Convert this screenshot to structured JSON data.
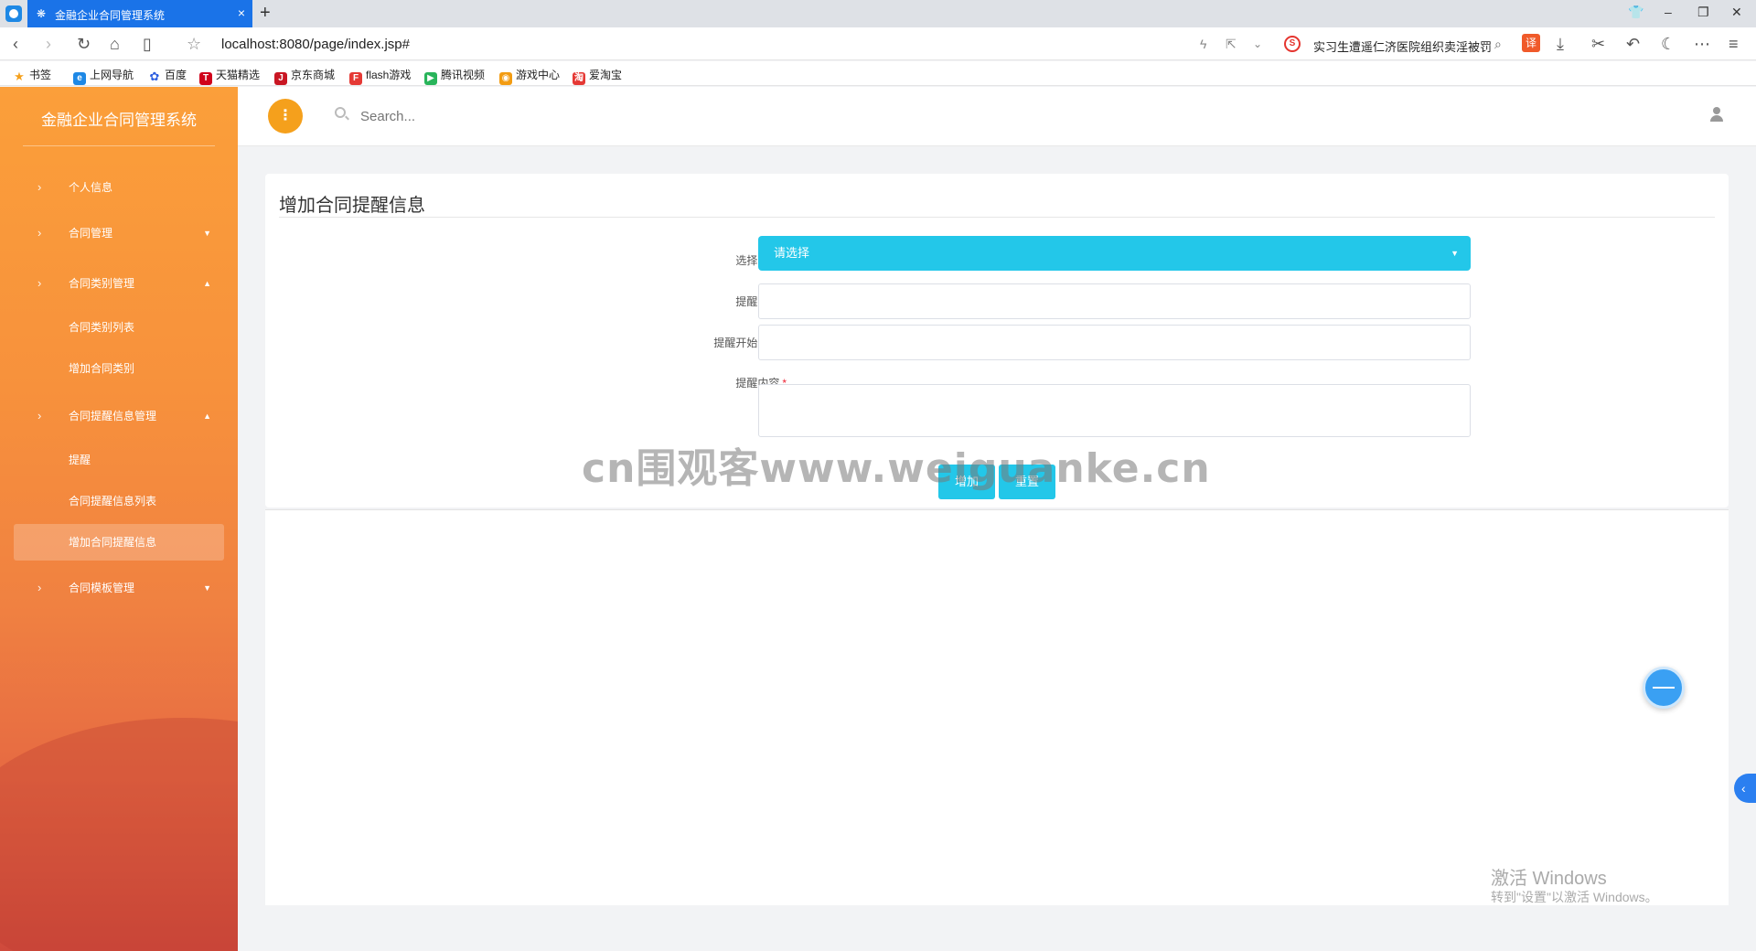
{
  "browser": {
    "tab_title": "金融企业合同管理系统",
    "tab_close": "×",
    "new_tab": "+",
    "address": "localhost:8080/page/index.jsp#",
    "news_ticker": "实习生遭遥仁济医院组织卖淫被罚",
    "translate_label": "译",
    "bookmarks": [
      {
        "label": "书签",
        "icon": "star-icon",
        "color": "#f5a01c"
      },
      {
        "label": "上网导航",
        "icon": "e-icon",
        "color": "#1e88e5"
      },
      {
        "label": "百度",
        "icon": "baidu-paw-icon",
        "color": "#2d5fe0"
      },
      {
        "label": "天猫精选",
        "icon": "tmall-icon",
        "color": "#d0021b"
      },
      {
        "label": "京东商城",
        "icon": "jd-icon",
        "color": "#c91623"
      },
      {
        "label": "flash游戏",
        "icon": "flash-icon",
        "color": "#e53935"
      },
      {
        "label": "腾讯视频",
        "icon": "tencent-video-icon",
        "color": "#28b45a"
      },
      {
        "label": "游戏中心",
        "icon": "game-center-icon",
        "color": "#f39c12"
      },
      {
        "label": "爱淘宝",
        "icon": "aitaobao-icon",
        "color": "#e53935"
      }
    ]
  },
  "sidebar": {
    "brand": "金融企业合同管理系统",
    "items": [
      {
        "label": "个人信息",
        "caret": ""
      },
      {
        "label": "合同管理",
        "caret": "▼"
      },
      {
        "label": "合同类别管理",
        "caret": "▲"
      },
      {
        "label": "合同类别列表"
      },
      {
        "label": "增加合同类别"
      },
      {
        "label": "合同提醒信息管理",
        "caret": "▲"
      },
      {
        "label": "提醒"
      },
      {
        "label": "合同提醒信息列表"
      },
      {
        "label": "增加合同提醒信息"
      },
      {
        "label": "合同模板管理",
        "caret": "▼"
      }
    ]
  },
  "header": {
    "search_placeholder": "Search..."
  },
  "form": {
    "title": "增加合同提醒信息",
    "required_mark": "*",
    "contract_label": "选择合同",
    "contract_value": "请选择",
    "name_label": "提醒名称",
    "start_label": "提醒开始时间",
    "content_label": "提醒内容",
    "add_label": "增加",
    "reset_label": "重置"
  },
  "overlay": {
    "watermark": "cn围观客www.weiguanke.cn",
    "activate_title": "激活 Windows",
    "activate_sub": "转到\"设置\"以激活 Windows。"
  },
  "colors": {
    "accent": "#23c7e9",
    "sidebar_top": "#fb9f3a",
    "sidebar_bottom": "#cf4a3c",
    "toggle": "#f5a01c"
  }
}
